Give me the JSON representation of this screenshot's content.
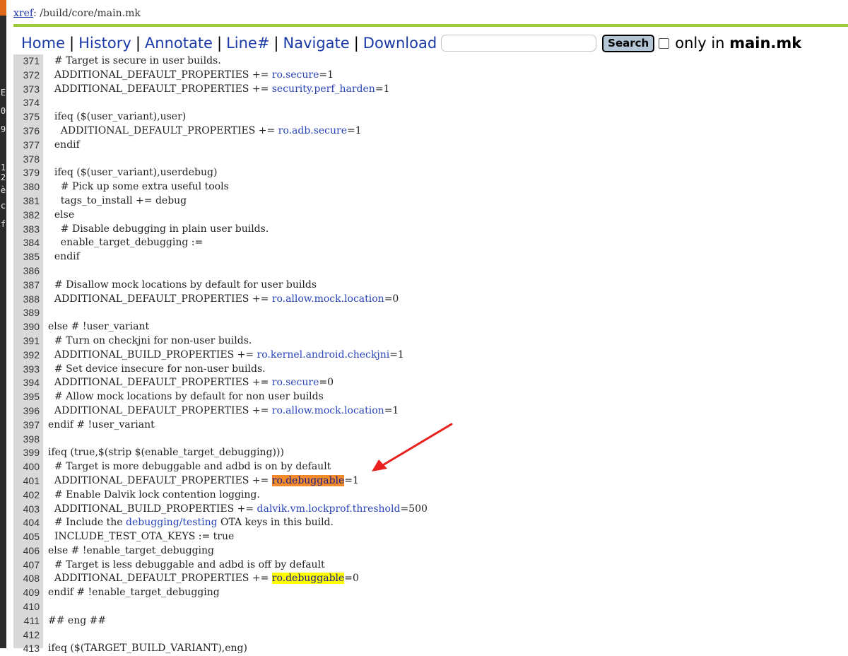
{
  "app": {
    "accent_color": "#9ccc3c",
    "link_color": "#1a3aa8",
    "highlight_colors": {
      "current": "#f08a2a",
      "other": "#ffff00"
    }
  },
  "xref": {
    "link_label": "xref",
    "path": ": /build/core/main.mk"
  },
  "nav": {
    "home": "Home",
    "history": "History",
    "annotate": "Annotate",
    "line_numbers": "Line#",
    "navigate": "Navigate",
    "download": "Download",
    "separator": "|",
    "search_value": "",
    "search_button": "Search",
    "only_in_prefix": "only in",
    "only_in_file": "main.mk"
  },
  "left_strip": {
    "fragments": [
      "E",
      "0",
      "9",
      "1",
      "2",
      "è",
      "c",
      "f"
    ]
  },
  "annotation": {
    "type": "arrow",
    "color": "#e8211e",
    "target_line": "400"
  },
  "code": {
    "lines": [
      {
        "num": "371",
        "parts": [
          {
            "t": "  # Target is secure in user builds."
          }
        ]
      },
      {
        "num": "372",
        "parts": [
          {
            "t": "  ADDITIONAL_DEFAULT_PROPERTIES += "
          },
          {
            "t": "ro.secure",
            "k": "link"
          },
          {
            "t": "=1"
          }
        ]
      },
      {
        "num": "373",
        "parts": [
          {
            "t": "  ADDITIONAL_DEFAULT_PROPERTIES += "
          },
          {
            "t": "security.perf_harden",
            "k": "link"
          },
          {
            "t": "=1"
          }
        ]
      },
      {
        "num": "374",
        "parts": []
      },
      {
        "num": "375",
        "parts": [
          {
            "t": "  ifeq ($(user_variant),user)"
          }
        ]
      },
      {
        "num": "376",
        "parts": [
          {
            "t": "    ADDITIONAL_DEFAULT_PROPERTIES += "
          },
          {
            "t": "ro.adb.secure",
            "k": "link"
          },
          {
            "t": "=1"
          }
        ]
      },
      {
        "num": "377",
        "parts": [
          {
            "t": "  endif"
          }
        ]
      },
      {
        "num": "378",
        "parts": []
      },
      {
        "num": "379",
        "parts": [
          {
            "t": "  ifeq ($(user_variant),userdebug)"
          }
        ]
      },
      {
        "num": "380",
        "parts": [
          {
            "t": "    # Pick up some extra useful tools"
          }
        ]
      },
      {
        "num": "381",
        "parts": [
          {
            "t": "    tags_to_install += debug"
          }
        ]
      },
      {
        "num": "382",
        "parts": [
          {
            "t": "  else"
          }
        ]
      },
      {
        "num": "383",
        "parts": [
          {
            "t": "    # Disable debugging in plain user builds."
          }
        ]
      },
      {
        "num": "384",
        "parts": [
          {
            "t": "    enable_target_debugging :="
          }
        ]
      },
      {
        "num": "385",
        "parts": [
          {
            "t": "  endif"
          }
        ]
      },
      {
        "num": "386",
        "parts": []
      },
      {
        "num": "387",
        "parts": [
          {
            "t": "  # Disallow mock locations by default for user builds"
          }
        ]
      },
      {
        "num": "388",
        "parts": [
          {
            "t": "  ADDITIONAL_DEFAULT_PROPERTIES += "
          },
          {
            "t": "ro.allow.mock.location",
            "k": "link"
          },
          {
            "t": "=0"
          }
        ]
      },
      {
        "num": "389",
        "parts": []
      },
      {
        "num": "390",
        "parts": [
          {
            "t": "else # !user_variant"
          }
        ]
      },
      {
        "num": "391",
        "parts": [
          {
            "t": "  # Turn on checkjni for non-user builds."
          }
        ]
      },
      {
        "num": "392",
        "parts": [
          {
            "t": "  ADDITIONAL_BUILD_PROPERTIES += "
          },
          {
            "t": "ro.kernel.android.checkjni",
            "k": "link"
          },
          {
            "t": "=1"
          }
        ]
      },
      {
        "num": "393",
        "parts": [
          {
            "t": "  # Set device insecure for non-user builds."
          }
        ]
      },
      {
        "num": "394",
        "parts": [
          {
            "t": "  ADDITIONAL_DEFAULT_PROPERTIES += "
          },
          {
            "t": "ro.secure",
            "k": "link"
          },
          {
            "t": "=0"
          }
        ]
      },
      {
        "num": "395",
        "parts": [
          {
            "t": "  # Allow mock locations by default for non user builds"
          }
        ]
      },
      {
        "num": "396",
        "parts": [
          {
            "t": "  ADDITIONAL_DEFAULT_PROPERTIES += "
          },
          {
            "t": "ro.allow.mock.location",
            "k": "link"
          },
          {
            "t": "=1"
          }
        ]
      },
      {
        "num": "397",
        "parts": [
          {
            "t": "endif # !user_variant"
          }
        ]
      },
      {
        "num": "398",
        "parts": []
      },
      {
        "num": "399",
        "parts": [
          {
            "t": "ifeq (true,$(strip $(enable_target_debugging)))"
          }
        ]
      },
      {
        "num": "400",
        "parts": [
          {
            "t": "  # Target is more debuggable and adbd is on by default"
          }
        ]
      },
      {
        "num": "401",
        "parts": [
          {
            "t": "  ADDITIONAL_DEFAULT_PROPERTIES += "
          },
          {
            "t": "ro.debuggable",
            "k": "hl-orange"
          },
          {
            "t": "=1"
          }
        ]
      },
      {
        "num": "402",
        "parts": [
          {
            "t": "  # Enable Dalvik lock contention logging."
          }
        ]
      },
      {
        "num": "403",
        "parts": [
          {
            "t": "  ADDITIONAL_BUILD_PROPERTIES += "
          },
          {
            "t": "dalvik.vm.lockprof.threshold",
            "k": "link"
          },
          {
            "t": "=500"
          }
        ]
      },
      {
        "num": "404",
        "parts": [
          {
            "t": "  # Include the "
          },
          {
            "t": "debugging/testing",
            "k": "link"
          },
          {
            "t": " OTA keys in this build."
          }
        ]
      },
      {
        "num": "405",
        "parts": [
          {
            "t": "  INCLUDE_TEST_OTA_KEYS := true"
          }
        ]
      },
      {
        "num": "406",
        "parts": [
          {
            "t": "else # !enable_target_debugging"
          }
        ]
      },
      {
        "num": "407",
        "parts": [
          {
            "t": "  # Target is less debuggable and adbd is off by default"
          }
        ]
      },
      {
        "num": "408",
        "parts": [
          {
            "t": "  ADDITIONAL_DEFAULT_PROPERTIES += "
          },
          {
            "t": "ro.debuggable",
            "k": "hl-yellow"
          },
          {
            "t": "=0"
          }
        ]
      },
      {
        "num": "409",
        "parts": [
          {
            "t": "endif # !enable_target_debugging"
          }
        ]
      },
      {
        "num": "410",
        "parts": []
      },
      {
        "num": "411",
        "parts": [
          {
            "t": "## eng ##"
          }
        ]
      },
      {
        "num": "412",
        "parts": []
      },
      {
        "num": "413",
        "parts": [
          {
            "t": "ifeq ($(TARGET_BUILD_VARIANT),eng)"
          }
        ]
      }
    ]
  }
}
